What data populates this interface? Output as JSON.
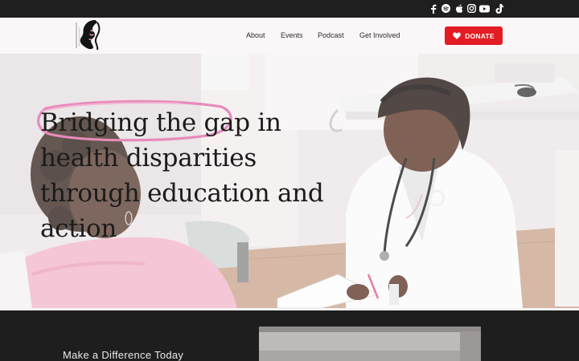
{
  "social": [
    {
      "icon": "facebook-icon"
    },
    {
      "icon": "spotify-icon"
    },
    {
      "icon": "apple-icon"
    },
    {
      "icon": "instagram-icon"
    },
    {
      "icon": "youtube-icon"
    },
    {
      "icon": "tiktok-icon"
    }
  ],
  "nav": {
    "about": "About",
    "events": "Events",
    "podcast": "Podcast",
    "get_involved": "Get Involved",
    "donate": "DONATE"
  },
  "hero": {
    "headline_highlight": "Bridging the gap",
    "headline_rest_1": " in",
    "headline_rest_2": "health disparities",
    "headline_rest_3": "through education and",
    "headline_rest_4": "action"
  },
  "section": {
    "cta": "Make a Difference Today"
  },
  "colors": {
    "accent": "#e31b23",
    "highlight": "#e88bbb",
    "topbar": "#1f1f1f",
    "navbar": "#fbf7f9"
  }
}
